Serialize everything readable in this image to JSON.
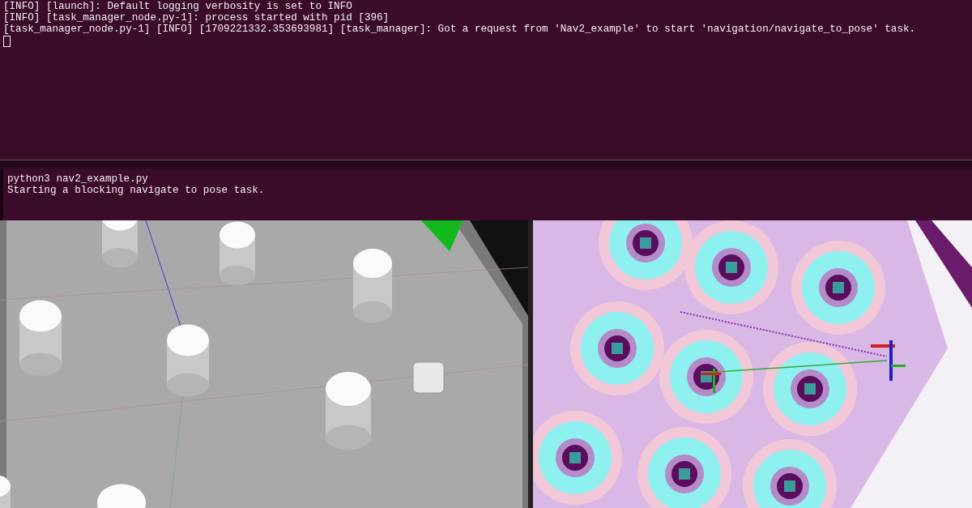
{
  "terminals": [
    {
      "lines": [
        "[INFO] [launch]: Default logging verbosity is set to INFO",
        "[INFO] [task_manager_node.py-1]: process started with pid [396]",
        "[task_manager_node.py-1] [INFO] [1709221332.353693981] [task_manager]: Got a request from 'Nav2_example' to start 'navigation/navigate_to_pose' task."
      ],
      "cursor": true
    },
    {
      "lines": [
        "python3 nav2_example.py",
        "Starting a blocking navigate to pose task."
      ],
      "cursor": false
    }
  ]
}
